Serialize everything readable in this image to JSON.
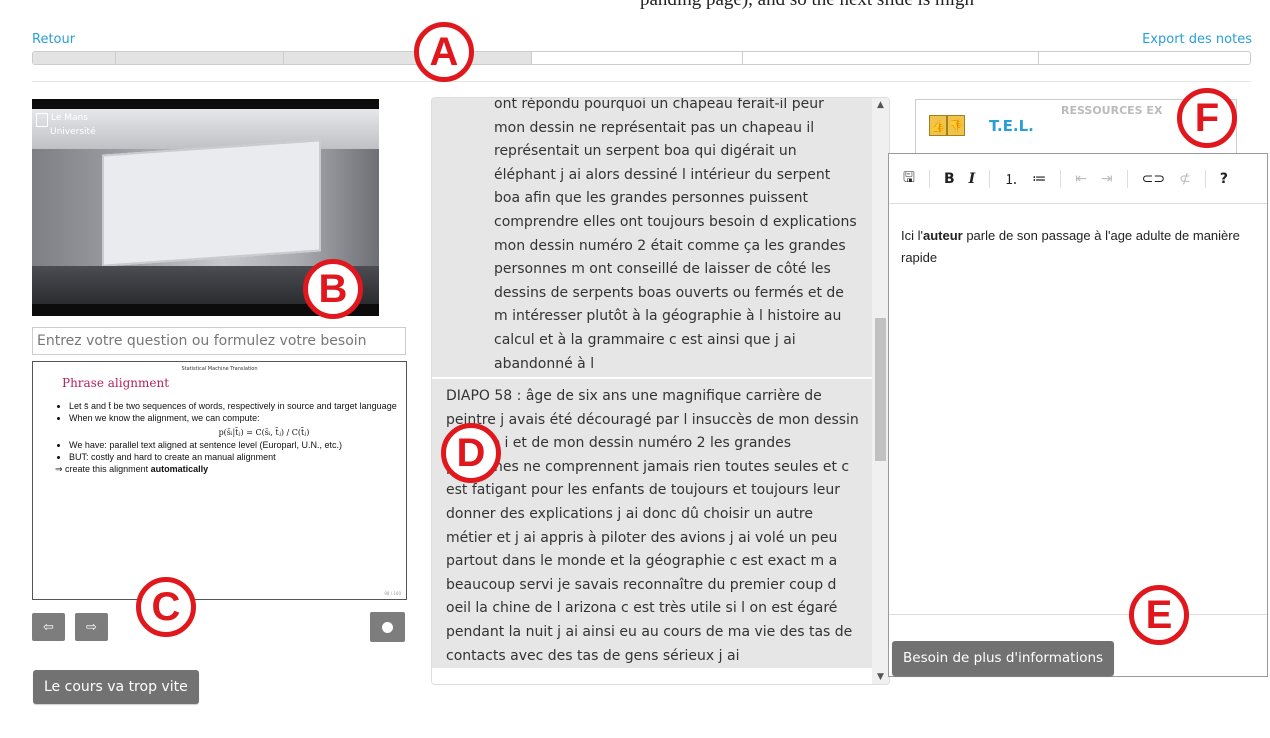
{
  "caption_fragment": "panding page), and so the next slide is migh",
  "top": {
    "back_label": "Retour",
    "export_label": "Export des notes"
  },
  "progress": {
    "segments": [
      {
        "done": true
      },
      {
        "done": true
      },
      {
        "done": true
      },
      {
        "done": false
      },
      {
        "done": false
      },
      {
        "done": false
      }
    ]
  },
  "markers": {
    "a": "A",
    "b": "B",
    "c": "C",
    "d": "D",
    "e": "E",
    "f": "F"
  },
  "video": {
    "logo_text_1": "Le Mans",
    "logo_text_2": "Université"
  },
  "question": {
    "placeholder": "Entrez votre question ou formulez votre besoin"
  },
  "slide": {
    "header": "Statistical Machine Translation",
    "title": "Phrase alignment",
    "bullets": [
      "Let s̄ and t̄ be two sequences of words, respectively in source and target language",
      "When we know the alignment, we can compute:",
      "We have: parallel text aligned at sentence level (Europarl, U.N., etc.)",
      "BUT: costly and hard to create an manual alignment"
    ],
    "formula": "p(s̄ᵢ|t̄ⱼ) = C(s̄ᵢ, t̄ⱼ) / C(t̄ⱼ)",
    "arrow_line_prefix": "create this alignment ",
    "arrow_line_bold": "automatically",
    "page_number": "98 / 100"
  },
  "nav": {
    "prev_icon": "arrow-left-icon",
    "next_icon": "arrow-right-icon",
    "prev_glyph": "⇦",
    "next_glyph": "⇨"
  },
  "buttons": {
    "too_fast": "Le cours va trop vite",
    "more_info": "Besoin de plus d'informations"
  },
  "transcript": {
    "para1": "ont répondu pourquoi un chapeau ferait-il peur mon dessin ne représentait pas un chapeau il représentait un serpent boa qui digérait un éléphant j ai alors dessiné l intérieur du serpent boa afin que les grandes personnes puissent comprendre elles ont toujours besoin d explications mon dessin numéro 2 était comme ça les grandes personnes m ont conseillé de laisser de côté les dessins de serpents boas ouverts ou fermés et de m intéresser plutôt à la géographie à l histoire au calcul et à la grammaire c est ainsi que j ai abandonné à l",
    "para2": "DIAPO 58 : âge de six ans une magnifique carrière de peintre j avais été découragé par l insuccès de mon dessin numéro i et de mon dessin numéro 2 les grandes personnes ne comprennent jamais rien toutes seules et c est fatigant pour les enfants de toujours et toujours leur donner des explications j ai donc dû choisir un autre métier et j ai appris à piloter des avions j ai volé un peu partout dans le monde et la géographie c est exact m a beaucoup servi je savais reconnaître du premier coup d oeil la chine de l arizona c est très utile si l on est égaré pendant la nuit j ai ainsi eu au cours de ma vie des tas de contacts avec des tas de gens sérieux j ai"
  },
  "resources": {
    "title": "RESSOURCES EX",
    "link": "T.E.L."
  },
  "editor": {
    "toolbar": {
      "save": "🖫",
      "bold": "B",
      "italic": "I",
      "ordered_list": "⒈",
      "bullet_list": "≔",
      "outdent": "⇤",
      "indent": "⇥",
      "link": "⊂⊃",
      "unlink": "⊄",
      "help": "?"
    },
    "text_before": "Ici l'",
    "text_bold": "auteur",
    "text_after": " parle de son passage à l'age adulte de manière rapide"
  }
}
